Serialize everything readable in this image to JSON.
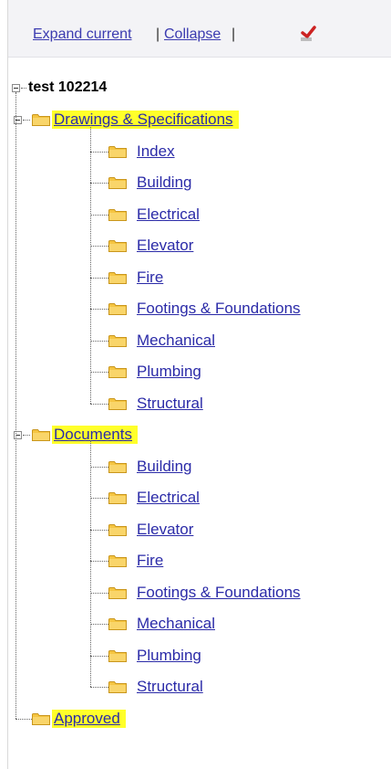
{
  "toolbar": {
    "expand_label": "Expand current",
    "separator1": "|",
    "collapse_label": "Collapse",
    "separator2": "|",
    "action_icon": "red-check-icon"
  },
  "tree": {
    "root_label": "test 102214",
    "groups": [
      {
        "label": "Drawings & Specifications",
        "highlighted": true,
        "children": [
          "Index",
          "Building",
          "Electrical",
          "Elevator",
          "Fire",
          "Footings & Foundations",
          "Mechanical",
          "Plumbing",
          "Structural"
        ]
      },
      {
        "label": "Documents",
        "highlighted": true,
        "children": [
          "Building",
          "Electrical",
          "Elevator",
          "Fire",
          "Footings & Foundations",
          "Mechanical",
          "Plumbing",
          "Structural"
        ]
      },
      {
        "label": "Approved",
        "highlighted": true,
        "children": []
      }
    ]
  },
  "colors": {
    "link": "#2b2ba8",
    "highlight": "#ffff2a",
    "folder": "#f5c542",
    "toolbar_bg": "#f3f3f6"
  }
}
